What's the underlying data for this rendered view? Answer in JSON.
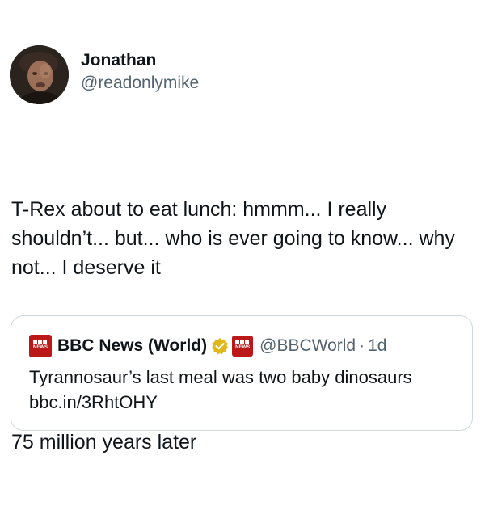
{
  "author": {
    "display_name": "Jonathan",
    "handle": "@readonlymike",
    "avatar_icon": "profile-photo"
  },
  "tweet": {
    "line_1": "T-Rex about to eat lunch: hmmm... I really shouldn’t... but... who is ever going to know... why not... I deserve it",
    "line_2": "75 million years later"
  },
  "quoted_tweet": {
    "display_name": "BBC News (World)",
    "logo_text": "NEWS",
    "verified_icon": "gold-verified-badge-icon",
    "handle": "@BBCWorld",
    "separator": "·",
    "time": "1d",
    "text": "Tyrannosaur’s last meal was two baby dinosaurs bbc.in/3RhtOHY"
  },
  "colors": {
    "text_primary": "#0f1419",
    "text_secondary": "#536471",
    "border": "#cfd9de",
    "bbc_red": "#bb1919",
    "verified_gold": "#e2b719"
  }
}
